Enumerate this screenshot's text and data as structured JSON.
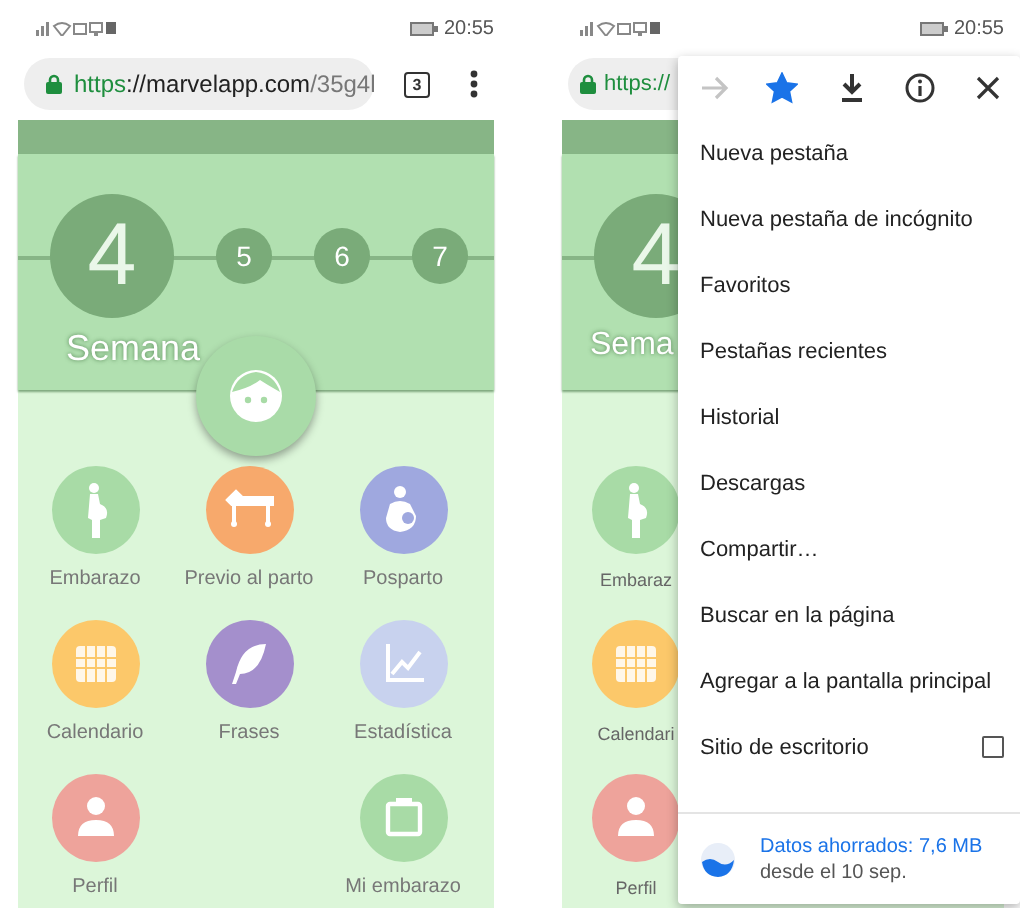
{
  "screens": [
    {
      "status_bar": {
        "time": "20:55"
      },
      "address_bar": {
        "parts": [
          {
            "text": "https",
            "kind": "scheme"
          },
          {
            "text": "://marvelapp.com",
            "kind": "host"
          },
          {
            "text": "/35g4l",
            "kind": "path"
          }
        ]
      },
      "tab_count": "3",
      "app": {
        "weeks": [
          {
            "number": "4",
            "selected": true
          },
          {
            "number": "5",
            "selected": false
          },
          {
            "number": "6",
            "selected": false
          },
          {
            "number": "7",
            "selected": false
          }
        ],
        "week_label": "Semana",
        "tiles": [
          {
            "label": "Embarazo",
            "kind": "pregnancy",
            "color": "#a8dba6"
          },
          {
            "label": "Previo al parto",
            "kind": "bed",
            "color": "#f7a96c"
          },
          {
            "label": "Posparto",
            "kind": "nursing",
            "color": "#9fa8df"
          },
          {
            "label": "Calendario",
            "kind": "calendar",
            "color": "#fcc86a"
          },
          {
            "label": "Frases",
            "kind": "feather",
            "color": "#a48fcc"
          },
          {
            "label": "Estadística",
            "kind": "chart",
            "color": "#c8d2ee"
          },
          {
            "label": "Perfil",
            "kind": "person",
            "color": "#eea39b"
          },
          {
            "label": "Mi embarazo",
            "kind": "clipboard",
            "color": "#a8dba6"
          }
        ]
      }
    },
    {
      "status_bar": {
        "time": "20:55"
      },
      "address_bar": {
        "parts": [
          {
            "text": "https://",
            "kind": "scheme"
          }
        ]
      },
      "app": {
        "weeks": [
          {
            "number": "4",
            "selected": true
          }
        ],
        "week_label": "Sema",
        "tiles": [
          {
            "label": "Embaraz",
            "kind": "pregnancy",
            "color": "#a8dba6"
          },
          {
            "label": "Calendari",
            "kind": "calendar",
            "color": "#fcc86a"
          },
          {
            "label": "Perfil",
            "kind": "person",
            "color": "#eea39b"
          }
        ]
      },
      "menu": {
        "toolbar": [
          {
            "kind": "forward",
            "disabled": true
          },
          {
            "kind": "bookmark",
            "disabled": false,
            "on": true
          },
          {
            "kind": "download",
            "disabled": false
          },
          {
            "kind": "info",
            "disabled": false
          },
          {
            "kind": "close",
            "disabled": false
          }
        ],
        "items": [
          {
            "label": "Nueva pestaña",
            "kind": "action"
          },
          {
            "label": "Nueva pestaña de incógnito",
            "kind": "action"
          },
          {
            "label": "Favoritos",
            "kind": "action"
          },
          {
            "label": "Pestañas recientes",
            "kind": "action"
          },
          {
            "label": "Historial",
            "kind": "action"
          },
          {
            "label": "Descargas",
            "kind": "action"
          },
          {
            "label": "Compartir…",
            "kind": "action"
          },
          {
            "label": "Buscar en la página",
            "kind": "action"
          },
          {
            "label": "Agregar a la pantalla principal",
            "kind": "action"
          },
          {
            "label": "Sitio de escritorio",
            "kind": "checkbox",
            "checked": false
          }
        ],
        "data_saver": {
          "title": "Datos ahorrados: 7,6 MB",
          "subtitle": "desde el 10 sep."
        }
      }
    }
  ]
}
